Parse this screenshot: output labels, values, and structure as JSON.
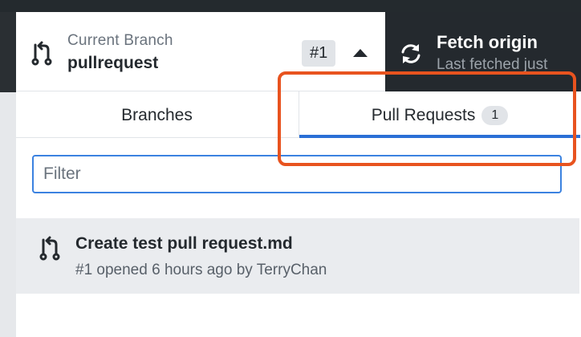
{
  "branch": {
    "caption": "Current Branch",
    "name": "pullrequest",
    "badge": "#1"
  },
  "fetch": {
    "title": "Fetch origin",
    "subtitle": "Last fetched just"
  },
  "tabs": [
    {
      "label": "Branches"
    },
    {
      "label": "Pull Requests",
      "count": "1"
    }
  ],
  "filter": {
    "placeholder": "Filter",
    "value": ""
  },
  "pull_requests": [
    {
      "title": "Create test pull request.md",
      "subtitle": "#1 opened 6 hours ago by TerryChan"
    }
  ],
  "colors": {
    "accent": "#2a6fd6",
    "annotation": "#e8531f",
    "toolbar_dark": "#24292e"
  },
  "icons": [
    "pull-request-icon",
    "sync-icon",
    "caret-up-icon"
  ]
}
